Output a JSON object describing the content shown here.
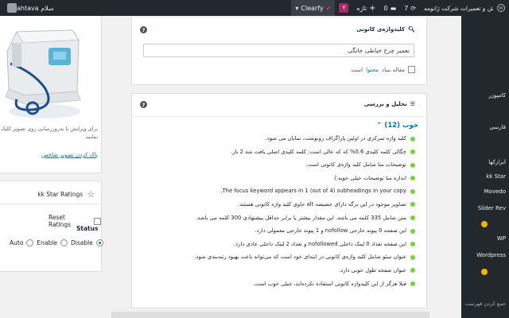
{
  "adminbar": {
    "site_name": "تارنمای رسمی فروش و تعمیرات شرکت ژانومه",
    "updates_count": "7",
    "comments_count": "0",
    "new_label": "تازه",
    "clearfy_label": "Clearfy",
    "howdy": "سلام ahtava"
  },
  "admin_menu": {
    "items": [
      "کامپوزر",
      "فارسی",
      "ابزارکها",
      "kk Star",
      "Movedo",
      "Slider Rev",
      "WP",
      "Wordpress",
      "جمع کردن فهرست"
    ]
  },
  "product_image": {
    "caption": "برای ویرایش یا به‌روزرسانی روی تصویر کلیک نمایید.",
    "remove_link": "پاک کردن تصویر شاخص"
  },
  "stars_panel": {
    "title": "kk Star Ratings",
    "reset_label": "Reset Ratings",
    "status_label": "Status",
    "options": [
      "Auto",
      "Enable",
      "Disable"
    ],
    "selected": "Disable"
  },
  "keyword_box": {
    "title": "کلیدواژه‌ی کانونی",
    "value": "تعمیر چرخ خیاطی خانگی",
    "pillar_prefix": "مقاله بنیاد",
    "pillar_link": "محتوا",
    "pillar_suffix": "است"
  },
  "analysis_box": {
    "title": "تحلیل و بررسی",
    "good_heading": "خوب (12)",
    "results": [
      "کلید واژه تمرکزی در اولین پاراگراف رونوشت، نمایان می شود.",
      "چگالی کلمه کلیدی 0.6% که که عالی است; کلمه کلیدی اصلی یافت شد 2 بار.",
      "توضیحات متا شامل کلید واژه‌ی کانونی است.",
      "اندازه متا توضیحات خیلی خوبه:)",
      "The focus keyword appears in 1 (out of 4) subheadings in your copy.",
      "تصاویر موجود در این برگه دارای خصیصه alt حاوی کلید واژه کانونی هستند.",
      "متن شامل 335 کلمه می باشد. این مقدار بیشتر یا برابر حداقل پیشنهادی 300 کلمه می باشد.",
      "این صفحه 0 پیوند خارجی nofollow و 1 پیوند خارجی معمولی دارد.",
      "این صفحه تعداد 0 لینک داخلی nofollowed و تعداد 2 لینک داخلی عادی دارد.",
      "عنوان سئو شامل کلید واژه‌ی کانونی در ابتدای خود است که می‌تواند باعث بهبود رتبه‌بندی شود.",
      "عنوان صفحه طول خوبی دارد.",
      "قبلا هرگز از این کلیدواژه کانونی استفاده نکرده‌اید، خیلی خوب است."
    ]
  },
  "colors": {
    "good": "#7ad03a",
    "link": "#0073aa",
    "adminbar": "#23282d"
  }
}
